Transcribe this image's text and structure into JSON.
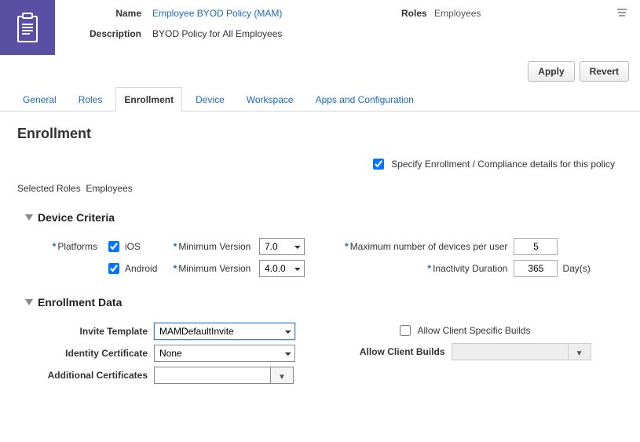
{
  "header": {
    "name_label": "Name",
    "name_value": "Employee BYOD Policy (MAM)",
    "description_label": "Description",
    "description_value": "BYOD Policy for All Employees",
    "roles_label": "Roles",
    "roles_value": "Employees"
  },
  "actions": {
    "apply": "Apply",
    "revert": "Revert"
  },
  "tabs": [
    "General",
    "Roles",
    "Enrollment",
    "Device",
    "Workspace",
    "Apps and Configuration"
  ],
  "active_tab_index": 2,
  "page_title": "Enrollment",
  "specify": {
    "checked": true,
    "label": "Specify Enrollment / Compliance details for this policy"
  },
  "selected_roles": {
    "label": "Selected Roles",
    "value": "Employees"
  },
  "device_criteria": {
    "heading": "Device Criteria",
    "platforms_label": "Platforms",
    "ios": {
      "checked": true,
      "label": "iOS",
      "minver_label": "Minimum Version",
      "minver_value": "7.0"
    },
    "android": {
      "checked": true,
      "label": "Android",
      "minver_label": "Minimum Version",
      "minver_value": "4.0.0"
    },
    "max_devices": {
      "label": "Maximum number of devices per user",
      "value": "5"
    },
    "inactivity": {
      "label": "Inactivity Duration",
      "value": "365",
      "unit": "Day(s)"
    }
  },
  "enrollment_data": {
    "heading": "Enrollment Data",
    "invite_template": {
      "label": "Invite Template",
      "value": "MAMDefaultInvite"
    },
    "identity_cert": {
      "label": "Identity Certificate",
      "value": "None"
    },
    "additional_certs": {
      "label": "Additional Certificates",
      "value": ""
    },
    "allow_client_specific": {
      "checked": false,
      "label": "Allow Client Specific Builds"
    },
    "allow_client_builds": {
      "label": "Allow Client Builds",
      "value": ""
    }
  }
}
